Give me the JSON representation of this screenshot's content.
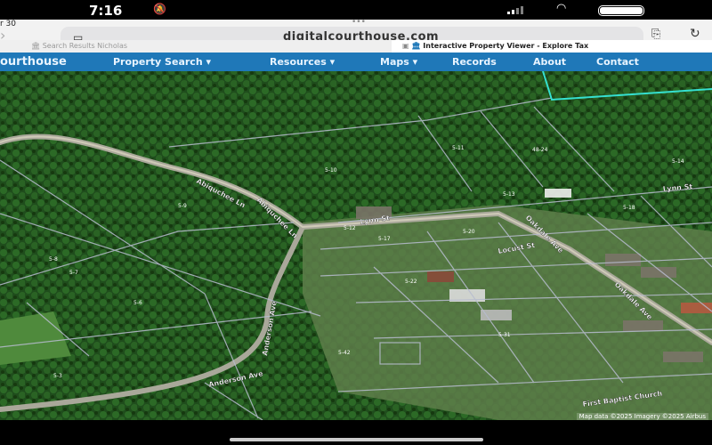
{
  "status_bar": {
    "time": "7:16",
    "silent_icon": "bell-slash-icon"
  },
  "browser": {
    "date": "r 30",
    "url": "digitalcourthouse.com",
    "tabs": [
      {
        "label": "Search Results Nicholas"
      },
      {
        "label": "Interactive Property Viewer - Explore Tax"
      }
    ]
  },
  "nav": {
    "brand": "ourthouse",
    "items": [
      "Property Search ▾",
      "Resources ▾",
      "Maps ▾",
      "Records",
      "About",
      "Contact"
    ]
  },
  "map": {
    "roads": [
      "Abiquchee Ln",
      "Abiquchee Ln",
      "Lynn St",
      "Lynn St",
      "Anderson Ave",
      "Anderson Ave",
      "Oakdale Ave",
      "Oakdale Ave",
      "Locust St",
      "First Baptist Church"
    ],
    "parcels": [
      "5-10",
      "5-9",
      "5-11",
      "48-24",
      "5-6",
      "5-7",
      "5-8",
      "5-3",
      "5-13",
      "5-14",
      "5-17",
      "5-18",
      "5-20",
      "5-22",
      "5-31",
      "5-12",
      "5-42"
    ],
    "attribution": "Map data ©2025 Imagery ©2025 Airbus"
  }
}
